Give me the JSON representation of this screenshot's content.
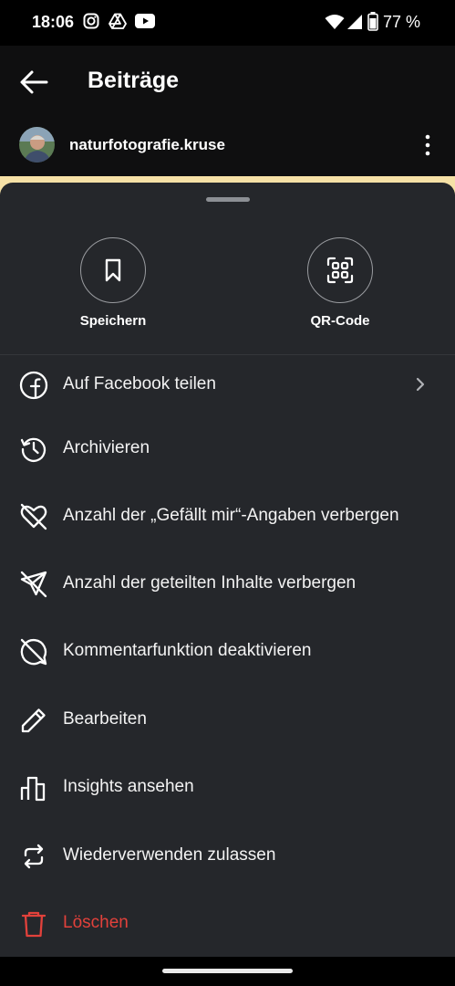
{
  "status": {
    "time": "18:06",
    "battery": "77 %"
  },
  "header": {
    "title": "Beiträge",
    "username": "naturfotografie.kruse"
  },
  "quick_actions": [
    {
      "label": "Speichern",
      "icon": "bookmark-icon"
    },
    {
      "label": "QR-Code",
      "icon": "qr-code-icon"
    }
  ],
  "menu": [
    {
      "label": "Auf Facebook teilen",
      "icon": "facebook-icon"
    },
    {
      "label": "Archivieren",
      "icon": "archive-history-icon"
    },
    {
      "label": "Anzahl der „Gefällt mir“-Angaben verbergen",
      "icon": "heart-off-icon"
    },
    {
      "label": "Anzahl der geteilten Inhalte verbergen",
      "icon": "share-off-icon"
    },
    {
      "label": "Kommentarfunktion deaktivieren",
      "icon": "comment-off-icon"
    },
    {
      "label": "Bearbeiten",
      "icon": "pencil-icon"
    },
    {
      "label": "Insights ansehen",
      "icon": "bar-chart-icon"
    },
    {
      "label": "Wiederverwenden zulassen",
      "icon": "remix-icon"
    },
    {
      "label": "Löschen",
      "icon": "trash-icon"
    }
  ],
  "colors": {
    "sheet": "#25272b",
    "danger": "#e2413b",
    "peek": "#f6e1a6"
  }
}
